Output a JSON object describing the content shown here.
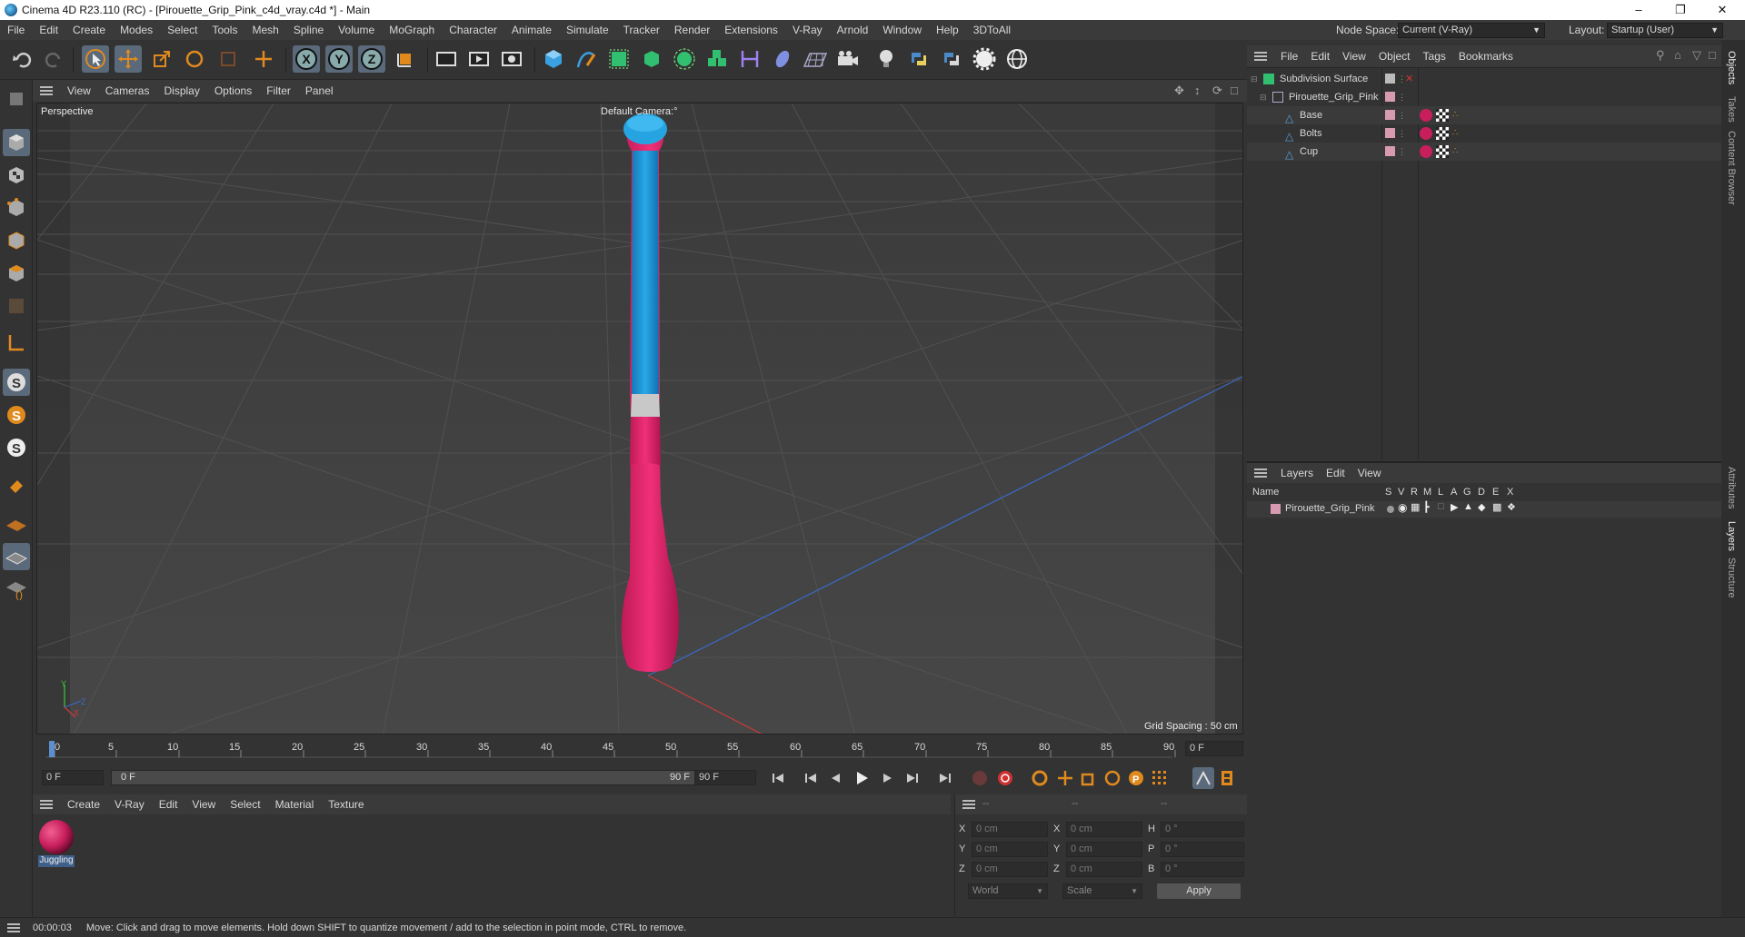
{
  "window": {
    "title": "Cinema 4D R23.110 (RC) - [Pirouette_Grip_Pink_c4d_vray.c4d *] - Main",
    "minimize": "–",
    "maximize": "❐",
    "close": "✕"
  },
  "menubar": {
    "items": [
      "File",
      "Edit",
      "Create",
      "Modes",
      "Select",
      "Tools",
      "Mesh",
      "Spline",
      "Volume",
      "MoGraph",
      "Character",
      "Animate",
      "Simulate",
      "Tracker",
      "Render",
      "Extensions",
      "V-Ray",
      "Arnold",
      "Window",
      "Help",
      "3DToAll"
    ],
    "node_space_label": "Node Space:",
    "node_space_value": "Current (V-Ray)",
    "layout_label": "Layout:",
    "layout_value": "Startup (User)"
  },
  "toolbar": {
    "axis_x": "X",
    "axis_y": "Y",
    "axis_z": "Z"
  },
  "viewport": {
    "menu": [
      "View",
      "Cameras",
      "Display",
      "Options",
      "Filter",
      "Panel"
    ],
    "label": "Perspective",
    "camera": "Default Camera",
    "camera_suffix": ":°",
    "grid_spacing": "Grid Spacing : 50 cm",
    "axis_y": "Y",
    "axis_z": "Z",
    "axis_x": "X",
    "colors": {
      "blue": "#1f9ad8",
      "pink": "#e8206a",
      "band": "#c8c8c8"
    }
  },
  "timeline": {
    "ticks": [
      "0",
      "5",
      "10",
      "15",
      "20",
      "25",
      "30",
      "35",
      "40",
      "45",
      "50",
      "55",
      "60",
      "65",
      "70",
      "75",
      "80",
      "85",
      "90"
    ],
    "current_frame": "0 F",
    "start": "0 F",
    "range_start": "0 F",
    "range_end": "90 F",
    "end": "90 F"
  },
  "materials": {
    "menu": [
      "Create",
      "V-Ray",
      "Edit",
      "View",
      "Select",
      "Material",
      "Texture"
    ],
    "items": [
      {
        "name": "Juggling",
        "color": "#c81e5c"
      }
    ]
  },
  "coords": {
    "header": [
      "--",
      "--",
      "--"
    ],
    "rows": [
      {
        "a": "X",
        "av": "0 cm",
        "b": "X",
        "bv": "0 cm",
        "c": "H",
        "cv": "0 °"
      },
      {
        "a": "Y",
        "av": "0 cm",
        "b": "Y",
        "bv": "0 cm",
        "c": "P",
        "cv": "0 °"
      },
      {
        "a": "Z",
        "av": "0 cm",
        "b": "Z",
        "bv": "0 cm",
        "c": "B",
        "cv": "0 °"
      }
    ],
    "world": "World",
    "scale": "Scale",
    "apply": "Apply"
  },
  "objects": {
    "menu": [
      "File",
      "Edit",
      "View",
      "Object",
      "Tags",
      "Bookmarks"
    ],
    "items": [
      {
        "name": "Subdivision Surface"
      },
      {
        "name": "Pirouette_Grip_Pink"
      },
      {
        "name": "Base"
      },
      {
        "name": "Bolts"
      },
      {
        "name": "Cup"
      }
    ]
  },
  "layers": {
    "menu": [
      "Layers",
      "Edit",
      "View"
    ],
    "name_header": "Name",
    "flags": [
      "S",
      "V",
      "R",
      "M",
      "L",
      "A",
      "G",
      "D",
      "E",
      "X"
    ],
    "items": [
      {
        "name": "Pirouette_Grip_Pink",
        "color": "#d89ab0"
      }
    ]
  },
  "sidetabs": [
    "Objects",
    "Takes",
    "Content Browser",
    "Attributes",
    "Layers",
    "Structure"
  ],
  "status": {
    "time": "00:00:03",
    "message": "Move: Click and drag to move elements. Hold down SHIFT to quantize movement / add to the selection in point mode, CTRL to remove."
  }
}
